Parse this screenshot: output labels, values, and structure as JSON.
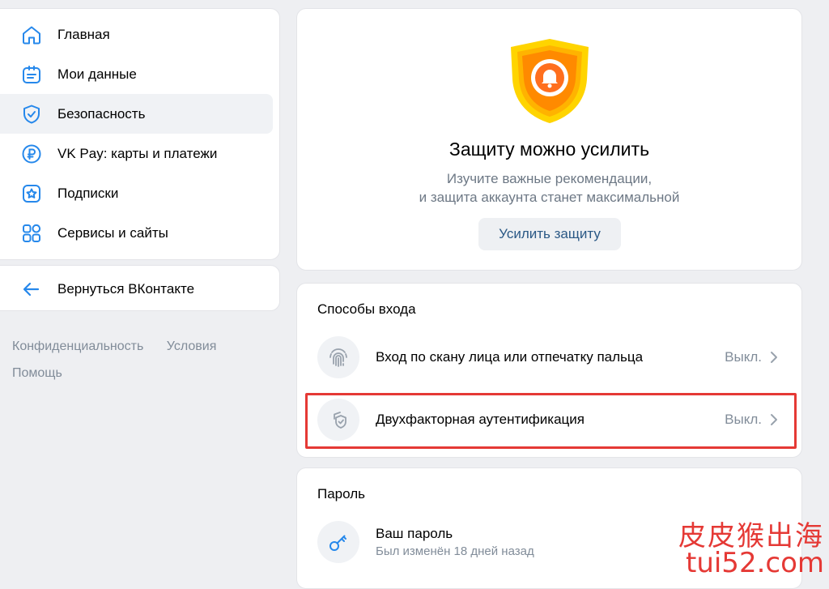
{
  "sidebar": {
    "items": [
      {
        "label": "Главная",
        "icon": "home-icon"
      },
      {
        "label": "Мои данные",
        "icon": "profile-card-icon"
      },
      {
        "label": "Безопасность",
        "icon": "shield-check-icon",
        "active": true
      },
      {
        "label": "VK Pay: карты и платежи",
        "icon": "ruble-icon"
      },
      {
        "label": "Подписки",
        "icon": "star-badge-icon"
      },
      {
        "label": "Сервисы и сайты",
        "icon": "apps-grid-icon"
      }
    ],
    "back_label": "Вернуться ВКонтакте",
    "back_icon": "arrow-left-icon"
  },
  "footer": {
    "privacy": "Конфиденциальность",
    "terms": "Условия",
    "help": "Помощь"
  },
  "hero": {
    "badge_icon": "shield-bell-icon",
    "title": "Защиту можно усилить",
    "subtitle_line1": "Изучите важные рекомендации,",
    "subtitle_line2": "и защита аккаунта станет максимальной",
    "button": "Усилить защиту"
  },
  "login_methods": {
    "title": "Способы входа",
    "rows": [
      {
        "label": "Вход по скану лица или отпечатку пальца",
        "status": "Выкл.",
        "icon": "fingerprint-icon"
      },
      {
        "label": "Двухфакторная аутентификация",
        "status": "Выкл.",
        "icon": "shield-copy-icon"
      }
    ]
  },
  "password": {
    "title": "Пароль",
    "row_label": "Ваш пароль",
    "row_sub": "Был изменён 18 дней назад",
    "icon": "key-icon"
  },
  "watermark": {
    "line1": "皮皮猴出海",
    "line2": "tui52.com"
  },
  "colors": {
    "accent": "#2688eb",
    "link": "#2a5885",
    "highlight": "#e53935",
    "secondary_text": "#818c99"
  }
}
